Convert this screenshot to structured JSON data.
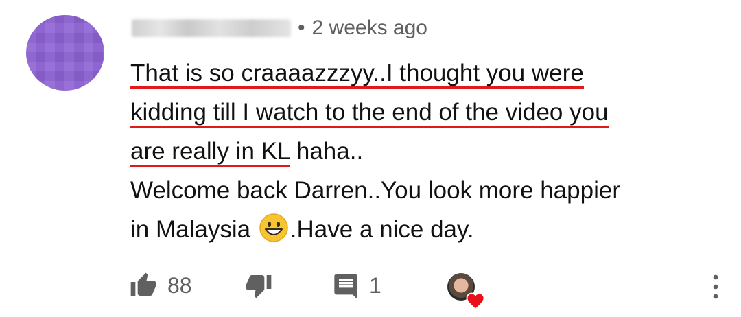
{
  "comment": {
    "timestamp": "2 weeks ago",
    "separator": "•",
    "lines": {
      "u1": "That is so craaaazzzyy..I thought you were",
      "u2": "kidding till I watch to the end of the video you",
      "u3": "are really in KL",
      "rest3": " haha..",
      "line4": "Welcome back Darren..You look more happier",
      "line5_pre": "in Malaysia ",
      "line5_post": ".Have a nice day."
    }
  },
  "actions": {
    "like_count": "88",
    "reply_count": "1"
  },
  "icons": {
    "avatar": "blurred-avatar",
    "like": "thumbs-up-icon",
    "dislike": "thumbs-down-icon",
    "reply": "comment-icon",
    "hearted": "creator-heart-icon",
    "more": "more-vert-icon",
    "emoji": "grinning-face-emoji"
  },
  "colors": {
    "avatar_bg": "#8e63d5",
    "underline": "#e01a1a",
    "heart": "#e8101a",
    "meta_text": "#606060"
  }
}
